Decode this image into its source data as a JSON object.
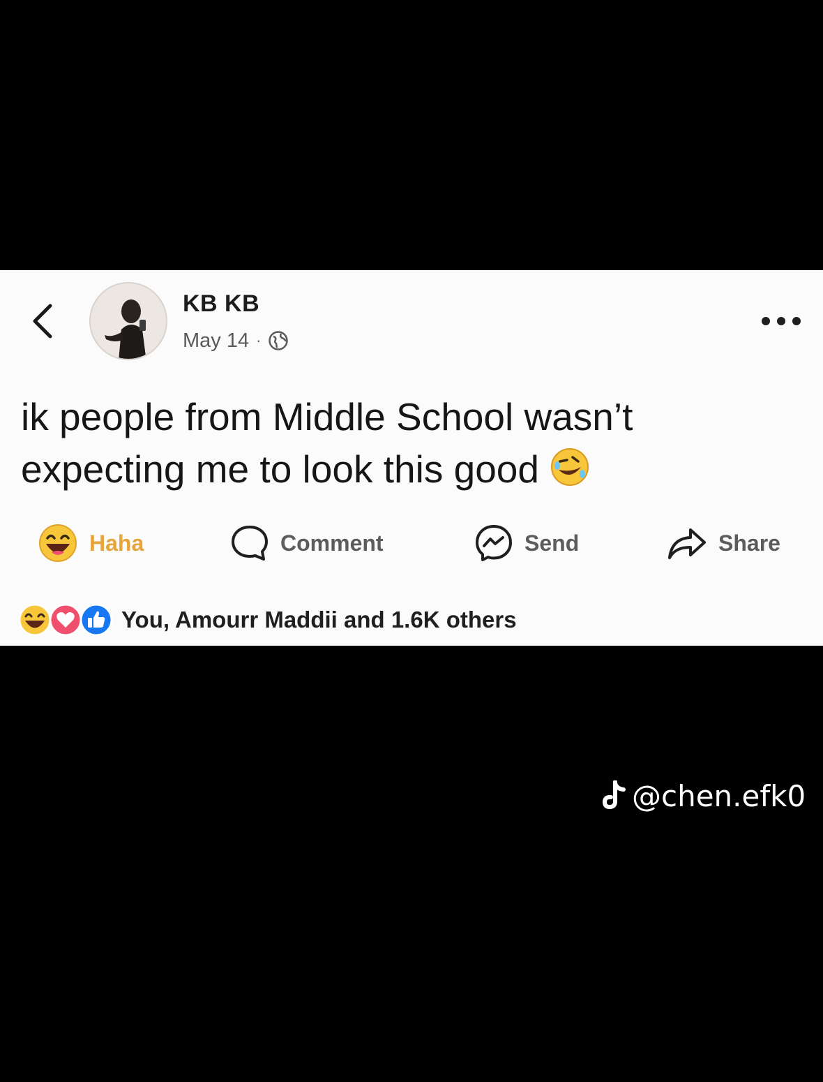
{
  "post": {
    "author": "KB KB",
    "date": "May 14",
    "separator": "·",
    "text_line1": "ik people from Middle School wasn’t",
    "text_line2": "expecting me to look this good"
  },
  "actions": {
    "haha": "Haha",
    "comment": "Comment",
    "send": "Send",
    "share": "Share"
  },
  "reactions": {
    "summary": "You, Amourr Maddii and 1.6K others"
  },
  "watermark": {
    "handle": "@chen.efk0"
  },
  "colors": {
    "haha_label": "#e6a43a",
    "like_blue": "#1877f2",
    "love_red": "#f0506e",
    "emoji_yellow": "#f7c63b"
  }
}
